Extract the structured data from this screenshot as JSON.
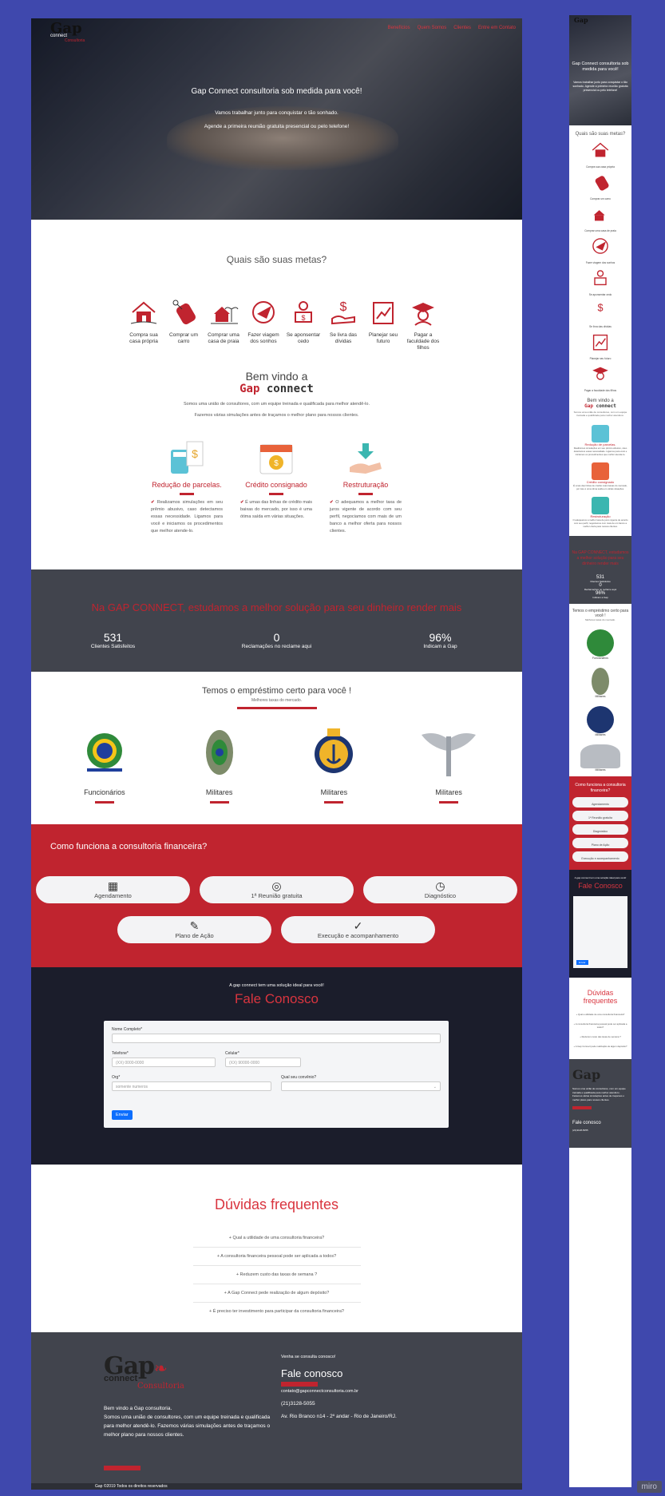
{
  "hero": {
    "logo_text": "Gap",
    "logo_sub": "connect",
    "logo_tag": "Consultoria",
    "nav": [
      "Benefícios",
      "Quem Somos",
      "Clientes",
      "Entre em Contato"
    ],
    "title": "Gap Connect consultoria sob medida para você!",
    "line1": "Vamos trabalhar junto para conquistar o tão sonhado.",
    "line2": "Agende a primeira reunião gratuita presencial ou pelo telefone!"
  },
  "goals": {
    "title": "Quais são suas metas?",
    "items": [
      {
        "label": "Compra sua casa própria",
        "icon": "house-icon"
      },
      {
        "label": "Comprar um carro",
        "icon": "car-key-icon"
      },
      {
        "label": "Comprar uma casa de praia",
        "icon": "beach-house-icon"
      },
      {
        "label": "Fazer viagem dos sonhos",
        "icon": "travel-icon"
      },
      {
        "label": "Se aponsentar cedo",
        "icon": "retirement-icon"
      },
      {
        "label": "Se livra das dívidas",
        "icon": "debt-icon"
      },
      {
        "label": "Planejar seu futuro",
        "icon": "planning-icon"
      },
      {
        "label": "Pagar a faculdade dos filhos",
        "icon": "graduation-icon"
      }
    ]
  },
  "welcome": {
    "title": "Bem vindo a",
    "brand_a": "Gap",
    "brand_b": " connect",
    "p1": "Somos uma união de consultores, com um equipe treinada e qualificada para melhor atendê-lo.",
    "p2": "Fazemos várias simulações antes de traçamos o melhor plano para nossos clientes."
  },
  "services": [
    {
      "title": "Redução de parcelas.",
      "text": "Realizamos simulações em seu prêmio abusivo, caso detectamos essas necessidade. Ligamos para você e iniciamos os procedimentos que melhor atende-lo."
    },
    {
      "title": "Crédito consignado",
      "text": "É umas das linhas de crédito mais baixas do mercado, por isso é uma ótima saída em várias situações."
    },
    {
      "title": "Restruturação",
      "text": "O adequamos a melhor taxa de juros vigente de acordo com seu perfil, negociamos com mais de um banco a melhor oferta para nossos clientes."
    }
  ],
  "stats": {
    "title": "Na GAP CONNECT, estudamos a melhor solução para seu dinheiro render mais",
    "items": [
      {
        "value": "531",
        "label": "Clientes Satisfeitos"
      },
      {
        "value": "0",
        "label": "Reclamações no reclame aqui"
      },
      {
        "value": "96%",
        "label": "Indicam a Gap"
      }
    ]
  },
  "loans": {
    "title": "Temos o empréstimo certo para você !",
    "sub": "Melhores taxas do mercado.",
    "items": [
      {
        "label": "Funcionários",
        "icon": "brazil-coat-of-arms-icon"
      },
      {
        "label": "Militares",
        "icon": "army-emblem-icon"
      },
      {
        "label": "Militares",
        "icon": "navy-emblem-icon"
      },
      {
        "label": "Militares",
        "icon": "air-force-emblem-icon"
      }
    ]
  },
  "howto": {
    "title": "Como funciona a consultoria financeira?",
    "steps": [
      "Agendamento",
      "1ª Reunião gratuita",
      "Diagnóstico",
      "Plano de Ação",
      "Execução e acompanhamento"
    ]
  },
  "contact": {
    "pre": "A gap connect tem uma solução ideal para você!",
    "title": "Fale Conosco",
    "name_label": "Nome Completo*",
    "phone_label": "Telefone*",
    "phone_ph": "(XX) 0000-0000",
    "cell_label": "Celular*",
    "cell_ph": "(XX) 90000-0000",
    "org_label": "Org*",
    "org_ph": "somente numeros",
    "agreement_label": "Qual seu convênio?",
    "submit": "Enviar"
  },
  "faq": {
    "title": "Dúvidas frequentes",
    "items": [
      "+ Qual a utilidade de uma consultoria financeira?",
      "+ A consultoria financeira pessoal pode ser aplicada a todos?",
      "+ Reduzem custo das taxas de semana ?",
      "+ A Gap Connect pede realização de algum depósito?",
      "+ É preciso ter investimento para participar da consultoria financeira?"
    ]
  },
  "footer": {
    "about_title": "Bem vindo a Gap consultoria.",
    "about_text": "Somos uma união de consultores, com um equipe treinada e qualificada para melhor atendê-lo. Fazemos várias simulações antes de traçamos o melhor plano para nossos clientes.",
    "contact_pre": "Venha se consulta conosco!",
    "contact_title": "Fale conosco",
    "email": "contato@gapconnectconsultoria.com.br",
    "phone": "(21)3128-5055",
    "address": "Av. Rio Branco n14 - 2º andar - Rio de Janeiro/RJ.",
    "copyright": "Gap ©2019 Todos os direitos reservados"
  },
  "mobile": {
    "hero_title": "Gap Connect consultoria sob medida para você!",
    "hero_sub": "Vamos trabalhar junto para conquistar o tão sonhado. Agende a primeira reunião gratuita presencial ou pelo telefone!"
  },
  "colors": {
    "accent": "#c0242f",
    "dark": "#41444d",
    "navy": "#1b1d2b",
    "canvas": "#3f48ad"
  },
  "watermark": "miro"
}
